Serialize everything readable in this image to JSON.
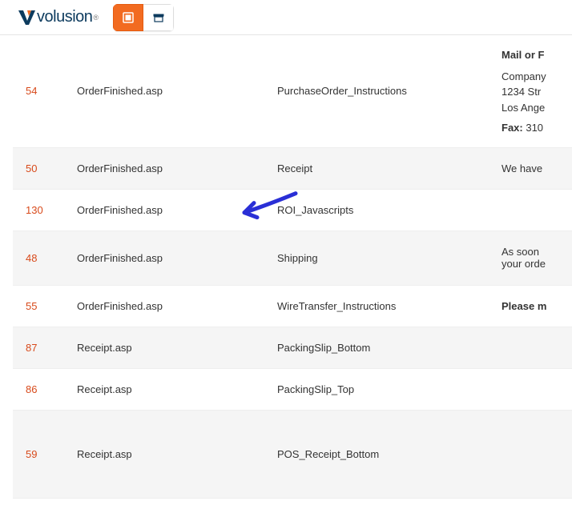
{
  "header": {
    "brand": "volusion"
  },
  "rows": [
    {
      "id": "54",
      "page": "OrderFinished.asp",
      "name": "PurchaseOrder_Instructions",
      "desc_heading": "Mail or F",
      "desc_lines": [
        "Company",
        "1234 Str",
        "Los Ange"
      ],
      "desc_suffix_label": "Fax:",
      "desc_suffix_value": " 310",
      "height": "tall",
      "odd": true
    },
    {
      "id": "50",
      "page": "OrderFinished.asp",
      "name": "Receipt",
      "desc_plain": "We have",
      "odd": false
    },
    {
      "id": "130",
      "page": "OrderFinished.asp",
      "name": "ROI_Javascripts",
      "odd": true,
      "arrow": true
    },
    {
      "id": "48",
      "page": "OrderFinished.asp",
      "name": "Shipping",
      "desc_lines2": [
        "As soon",
        "your orde"
      ],
      "height": "med",
      "odd": false
    },
    {
      "id": "55",
      "page": "OrderFinished.asp",
      "name": "WireTransfer_Instructions",
      "desc_bold": "Please m",
      "odd": true
    },
    {
      "id": "87",
      "page": "Receipt.asp",
      "name": "PackingSlip_Bottom",
      "odd": false,
      "height": "short"
    },
    {
      "id": "86",
      "page": "Receipt.asp",
      "name": "PackingSlip_Top",
      "odd": true,
      "height": "short"
    },
    {
      "id": "59",
      "page": "Receipt.asp",
      "name": "POS_Receipt_Bottom",
      "odd": false,
      "height": "vtall"
    }
  ]
}
